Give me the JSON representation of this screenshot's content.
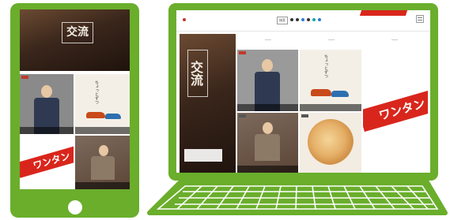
{
  "tablet": {
    "hero": {
      "title": "交流"
    }
  },
  "laptop": {
    "header": {
      "search_label": "検索"
    },
    "hero": {
      "title": "交流"
    },
    "feature_text": "ちょっとずつ",
    "package_label": "ワンタン"
  },
  "colors": {
    "device_frame": "#6aae2c",
    "promo_red": "#d9261c",
    "hero_dark": "#3a261b"
  }
}
